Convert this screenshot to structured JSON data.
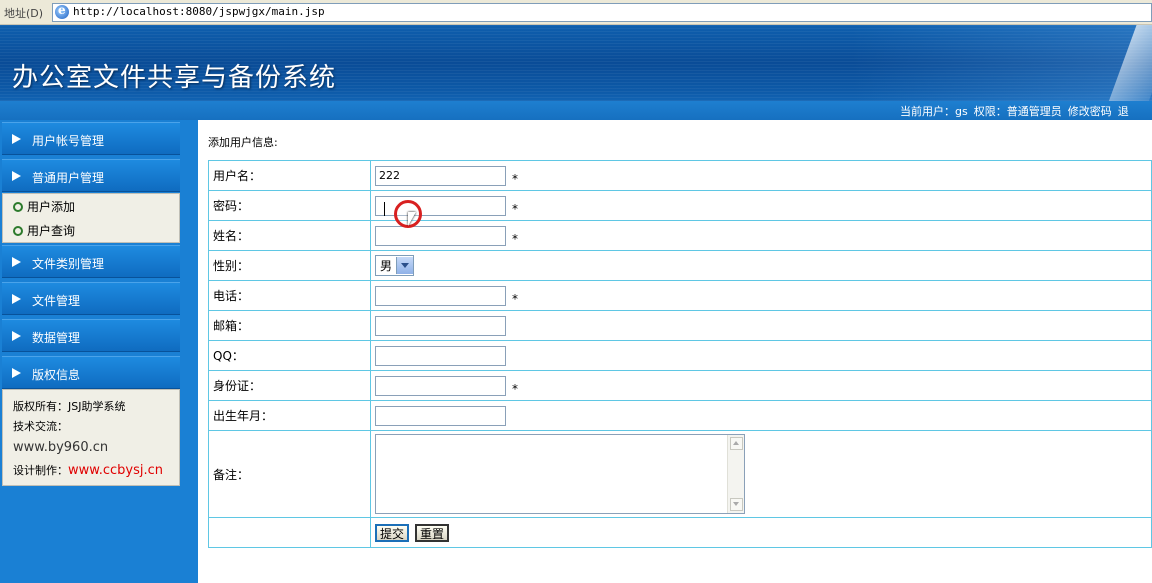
{
  "browser": {
    "address_label": "地址(D)",
    "url": "http://localhost:8080/jspwjgx/main.jsp"
  },
  "header": {
    "title": "办公室文件共享与备份系统",
    "user_info": {
      "current_user": "当前用户：gs",
      "role": "权限：普通管理员",
      "change_password": "修改密码",
      "logout": "退"
    }
  },
  "sidebar": {
    "menus": [
      {
        "label": "用户帐号管理"
      },
      {
        "label": "普通用户管理"
      },
      {
        "label": "文件类别管理"
      },
      {
        "label": "文件管理"
      },
      {
        "label": "数据管理"
      },
      {
        "label": "版权信息"
      }
    ],
    "submenu": [
      {
        "label": "用户添加"
      },
      {
        "label": "用户查询"
      }
    ],
    "copyright": {
      "owner": "版权所有：JSJ助学系统",
      "contact_label": "技术交流：",
      "contact_url": "www.by960.cn",
      "design_label": "设计制作：",
      "design_url": "www.ccbysj.cn"
    }
  },
  "form": {
    "title": "添加用户信息:",
    "required_mark": "*",
    "fields": {
      "username": {
        "label": "用户名：",
        "value": "222"
      },
      "password": {
        "label": "密码：",
        "value": ""
      },
      "name": {
        "label": "姓名：",
        "value": ""
      },
      "gender": {
        "label": "性别：",
        "value": "男"
      },
      "phone": {
        "label": "电话：",
        "value": ""
      },
      "email": {
        "label": "邮箱：",
        "value": ""
      },
      "qq": {
        "label": "QQ：",
        "value": ""
      },
      "idcard": {
        "label": "身份证：",
        "value": ""
      },
      "birth": {
        "label": "出生年月：",
        "value": ""
      },
      "remark": {
        "label": "备注：",
        "value": ""
      }
    },
    "submit_label": "提交",
    "reset_label": "重置"
  }
}
